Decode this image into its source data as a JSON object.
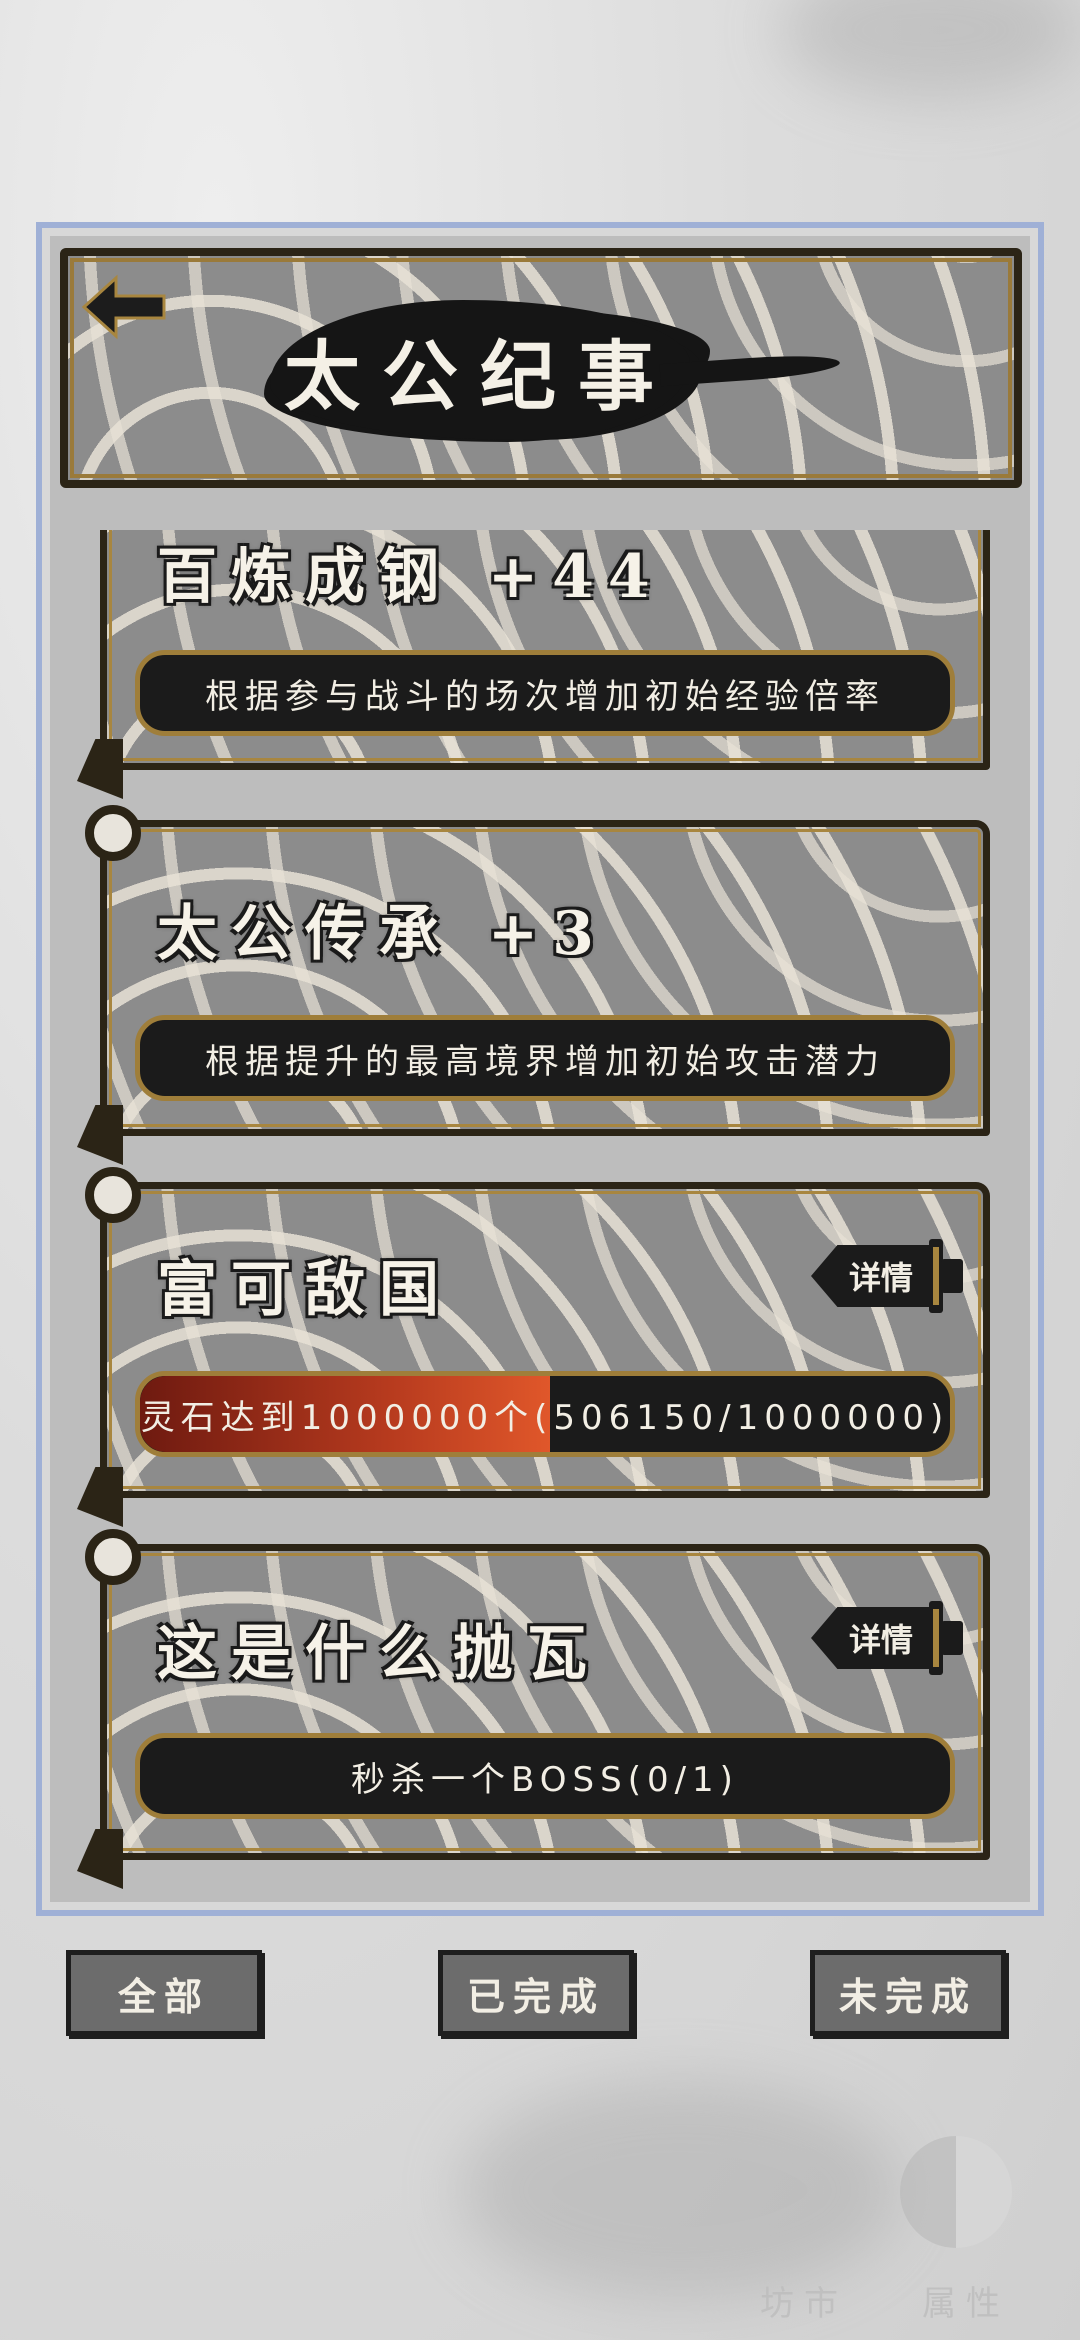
{
  "header": {
    "title": "太公纪事"
  },
  "achievements": [
    {
      "title": "百炼成钢 +44",
      "description": "根据参与战斗的场次增加初始经验倍率"
    },
    {
      "title": "太公传承 +3",
      "description": "根据提升的最高境界增加初始攻击潜力"
    },
    {
      "title": "富可敌国",
      "detail_label": "详情",
      "progress_text": "灵石达到1000000个(506150/1000000)",
      "progress_value": 0.50615
    },
    {
      "title": "这是什么抛瓦",
      "detail_label": "详情",
      "progress_text": "秒杀一个BOSS(0/1)",
      "progress_value": 0
    }
  ],
  "tabs": [
    "全部",
    "已完成",
    "未完成"
  ],
  "background": {
    "label_1": "坊市",
    "label_2": "属性"
  },
  "colors": {
    "progress": "#c0401f",
    "frame": "#2b2416",
    "trim": "#a8863f"
  }
}
